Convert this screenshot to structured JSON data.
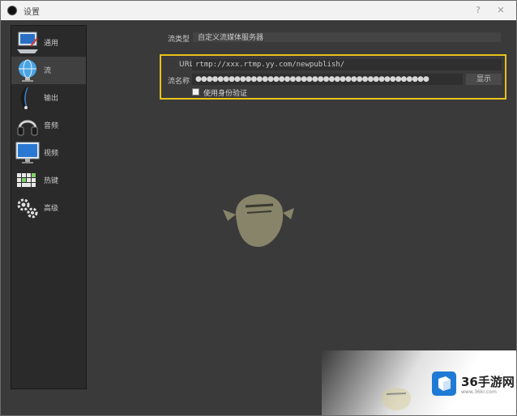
{
  "window": {
    "title": "设置",
    "help_glyph": "?",
    "close_glyph": "✕"
  },
  "sidebar": {
    "items": [
      {
        "label": "通用",
        "icon": "general-monitor-icon"
      },
      {
        "label": "流",
        "icon": "stream-globe-icon"
      },
      {
        "label": "输出",
        "icon": "output-icon"
      },
      {
        "label": "音频",
        "icon": "audio-headphones-icon"
      },
      {
        "label": "视频",
        "icon": "video-monitor-icon"
      },
      {
        "label": "热键",
        "icon": "hotkeys-keyboard-icon"
      },
      {
        "label": "高级",
        "icon": "advanced-gears-icon"
      }
    ],
    "active_index": 1
  },
  "stream": {
    "type_label": "流类型",
    "type_value": "自定义流媒体服务器",
    "url_label": "URL",
    "url_value": "rtmp://xxx.rtmp.yy.com/newpublish/",
    "key_label": "流名称",
    "key_value": "●●●●●●●●●●●●●●●●●●●●●●●●●●●●●●●●●●●●●●●●●●",
    "show_button": "显示",
    "auth_label": "使用身份验证"
  },
  "watermark": {
    "brand": "36手游网",
    "domain": "www.36kr.com"
  },
  "colors": {
    "highlight": "#e8c21a",
    "panel": "#3a3a3a",
    "sidebar": "#2a2a2a"
  }
}
